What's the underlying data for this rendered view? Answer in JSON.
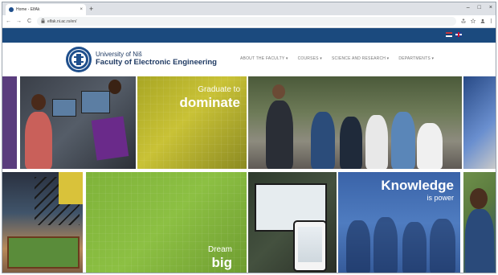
{
  "browser": {
    "tab_title": "Home - ElfAk",
    "tab_close": "×",
    "new_tab": "+",
    "url": "elfak.ni.ac.rs/en/",
    "lock_glyph": "🔒",
    "back": "←",
    "forward": "→",
    "reload": "C",
    "window_controls": {
      "minimize": "–",
      "maximize": "□",
      "close": "×"
    },
    "toolbar_icons": [
      "share-icon",
      "star-icon",
      "profile-icon",
      "menu-icon"
    ]
  },
  "site": {
    "topbar_color": "#1b4a7e",
    "languages": [
      "Serbian",
      "English"
    ],
    "university": "University of Niš",
    "faculty": "Faculty of Electronic Engineering",
    "nav": [
      "ABOUT THE FACULTY ▾",
      "COURSES ▾",
      "SCIENCE AND RESEARCH ▾",
      "DEPARTMENTS ▾"
    ]
  },
  "hero": {
    "graduate": "Graduate to",
    "dominate": "dominate",
    "dream": "Dream",
    "big": "big",
    "knowledge": "Knowledge",
    "power": "is power"
  }
}
